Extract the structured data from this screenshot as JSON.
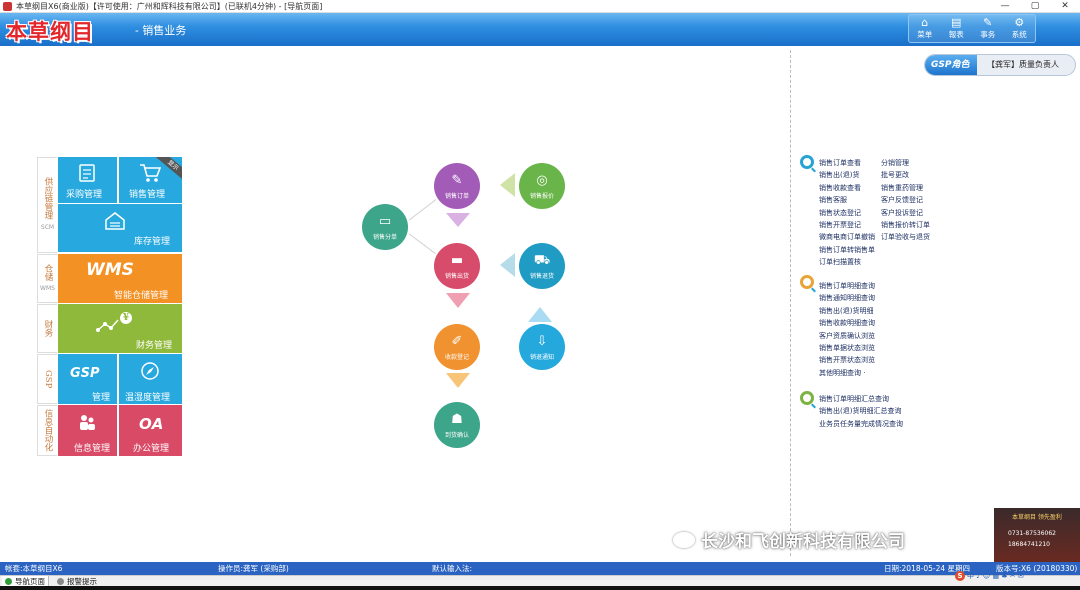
{
  "window": {
    "title": "本草纲目X6(商业版)【许可使用：广州和辉科技有限公司】(已联机4分钟) - [导航页面]",
    "min_btn": "—",
    "max_btn": "▢",
    "close_btn": "✕"
  },
  "header": {
    "logo": "本草纲目",
    "module": "- 销售业务",
    "menu": [
      {
        "label": "菜单",
        "icon": "home-icon",
        "glyph": "⌂"
      },
      {
        "label": "報表",
        "icon": "book-icon",
        "glyph": "▤"
      },
      {
        "label": "事务",
        "icon": "edit-icon",
        "glyph": "✎"
      },
      {
        "label": "系统",
        "icon": "gear-icon",
        "glyph": "⚙"
      }
    ]
  },
  "gsp_role": {
    "tag": "GSP角色",
    "name": "【龚军】质量负责人"
  },
  "modules": {
    "groups": [
      {
        "label": "供应链管理",
        "sub": "SCM"
      },
      {
        "label": "仓储",
        "sub": "WMS"
      },
      {
        "label": "财务",
        "sub": ""
      },
      {
        "label": "GSP",
        "sub": ""
      },
      {
        "label": "信息自动化",
        "sub": ""
      }
    ],
    "tiles": {
      "purchase": "采购管理",
      "sales": "销售管理",
      "sales_ribbon": "显示",
      "inventory": "库存管理",
      "wms_logo": "WMS",
      "wms": "智能仓储管理",
      "finance": "财务管理",
      "finance_glyph": "¥",
      "gsp_logo": "GSP",
      "gsp": "管理",
      "temp": "温湿度管理",
      "info": "信息管理",
      "oa_logo": "OA",
      "oa": "办公管理"
    }
  },
  "flow": {
    "nodes": {
      "order": {
        "label": "销售订单",
        "glyph": "✎"
      },
      "quote": {
        "label": "销售报价",
        "glyph": "◎"
      },
      "split": {
        "label": "销售分单",
        "glyph": "▭"
      },
      "out": {
        "label": "销售出货",
        "glyph": "▬"
      },
      "return": {
        "label": "销售退货",
        "glyph": "⛟"
      },
      "collect": {
        "label": "收款登记",
        "glyph": "✐"
      },
      "notice": {
        "label": "销退通知",
        "glyph": "⇩"
      },
      "confirm": {
        "label": "到货确认",
        "glyph": "☗"
      }
    },
    "colors": {
      "purple": "#a35bb8",
      "green": "#6ab54a",
      "teal": "#3ca58a",
      "red": "#d74b6b",
      "blue": "#1f9bc4",
      "orange": "#f0922f",
      "cyan": "#25a9dc"
    }
  },
  "links": {
    "section1": [
      [
        "销售订单查看",
        "分销管理"
      ],
      [
        "销售出(退)货",
        "批号更改"
      ],
      [
        "销售收款查看",
        "销售重药管理"
      ],
      [
        "销售客服",
        "客户反馈登记"
      ],
      [
        "销售状态登记",
        "客户投诉登记"
      ],
      [
        "销售开票登记",
        "销售报价转订单"
      ],
      [
        "微商电商订单撤销",
        "订单验收与退货"
      ],
      [
        "销售订单转销售单",
        ""
      ],
      [
        "订单扫描置核",
        ""
      ]
    ],
    "section2": [
      "销售订单明细查询",
      "销售通知明细查询",
      "销售出(退)货明细",
      "销售收款明细查询",
      "客户资质确认浏览",
      "销售单据状态浏览",
      "销售开票状态浏览",
      "其他明细查询 ·"
    ],
    "section3": [
      "销售订单明细汇总查询",
      "销售出(退)货明细汇总查询",
      "业务员任务量完成情况查询"
    ]
  },
  "status": {
    "account": "帐套:本草纲目X6",
    "operator": "操作员:龚军 (采购部)",
    "input": "默认输入法:",
    "date": "日期:2018-05-24 星期四",
    "version": "版本号:X6 (20180330)"
  },
  "bottom_tabs": [
    {
      "label": "导航页面",
      "color": "#2f9e3a"
    },
    {
      "label": "报警提示",
      "color": "#8a8a8a"
    }
  ],
  "tray": {
    "s": "S",
    "items": "中 ♪ ☺ ▦ ♣ ✂ ✉"
  },
  "watermark": "长沙和飞创新科技有限公司",
  "promo": {
    "line1": "本草纲目 领先盈利",
    "line2": "0731-87536062",
    "line3": "18684741210"
  }
}
